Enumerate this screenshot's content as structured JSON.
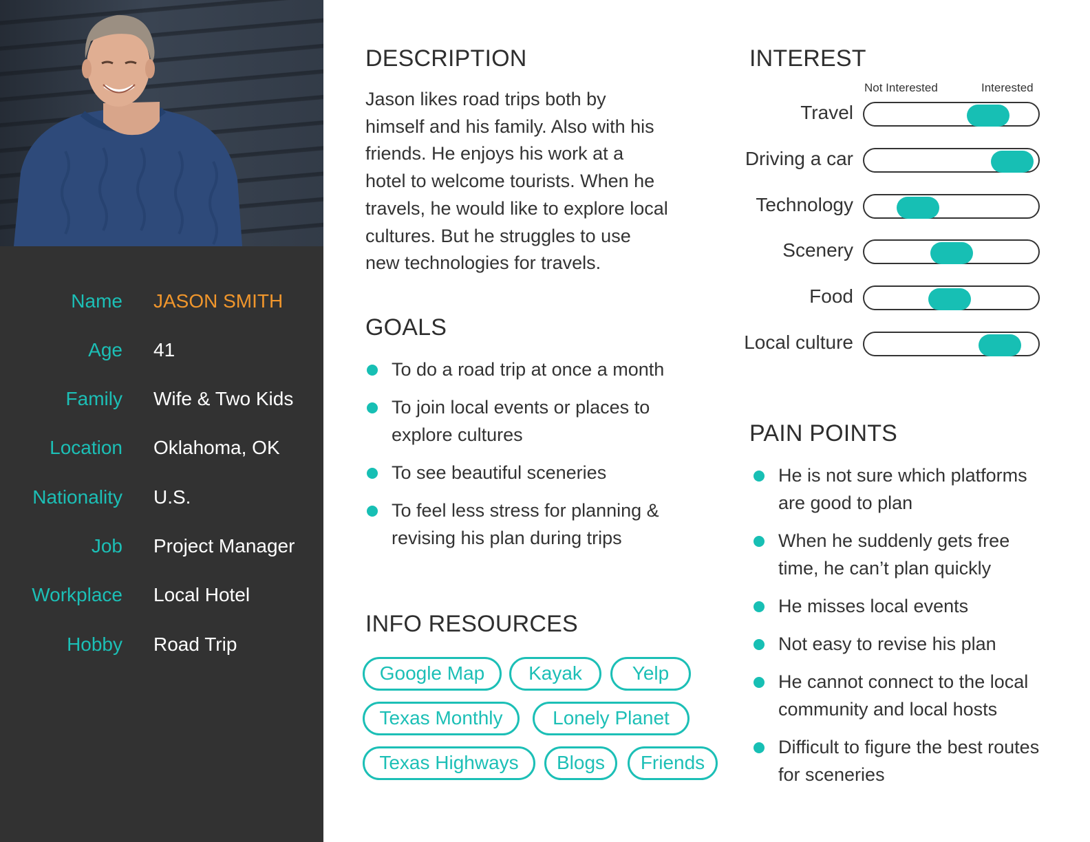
{
  "profile": {
    "fields": [
      {
        "label": "Name",
        "value": "JASON SMITH"
      },
      {
        "label": "Age",
        "value": "41"
      },
      {
        "label": "Family",
        "value": "Wife & Two Kids"
      },
      {
        "label": "Location",
        "value": "Oklahoma, OK"
      },
      {
        "label": "Nationality",
        "value": "U.S."
      },
      {
        "label": "Job",
        "value": "Project Manager"
      },
      {
        "label": "Workplace",
        "value": "Local Hotel"
      },
      {
        "label": "Hobby",
        "value": "Road Trip"
      }
    ]
  },
  "description": {
    "heading": "DESCRIPTION",
    "text": "Jason likes road trips both by himself and his family. Also with his friends. He enjoys his work at a hotel to welcome tourists. When he travels, he would like to explore local cultures. But he struggles to use new technologies for travels."
  },
  "goals": {
    "heading": "GOALS",
    "items": [
      "To do a road trip at once a month",
      "To join local events or places to explore cultures",
      "To see beautiful sceneries",
      "To feel less stress for planning & revising his plan during trips"
    ]
  },
  "info_resources": {
    "heading": "INFO RESOURCES",
    "tags": [
      "Google Map",
      "Kayak",
      "Yelp",
      "Texas Monthly",
      "Lonely Planet",
      "Texas Highways",
      "Blogs",
      "Friends"
    ]
  },
  "interest": {
    "heading": "INTEREST",
    "scale_low": "Not Interested",
    "scale_high": "Interested",
    "items": [
      {
        "label": "Travel",
        "level": 0.71
      },
      {
        "label": "Driving a car",
        "level": 0.85
      },
      {
        "label": "Technology",
        "level": 0.31
      },
      {
        "label": "Scenery",
        "level": 0.5
      },
      {
        "label": "Food",
        "level": 0.49
      },
      {
        "label": "Local culture",
        "level": 0.78
      }
    ],
    "accent_color": "#17bfb4"
  },
  "pain_points": {
    "heading": "PAIN POINTS",
    "items": [
      "He is not sure which platforms are good to plan",
      "When he suddenly gets free time, he can’t plan quickly",
      "He misses local events",
      "Not easy to revise his plan",
      "He cannot connect to the local community and local hosts",
      "Difficult to figure the best routes for sceneries"
    ]
  }
}
